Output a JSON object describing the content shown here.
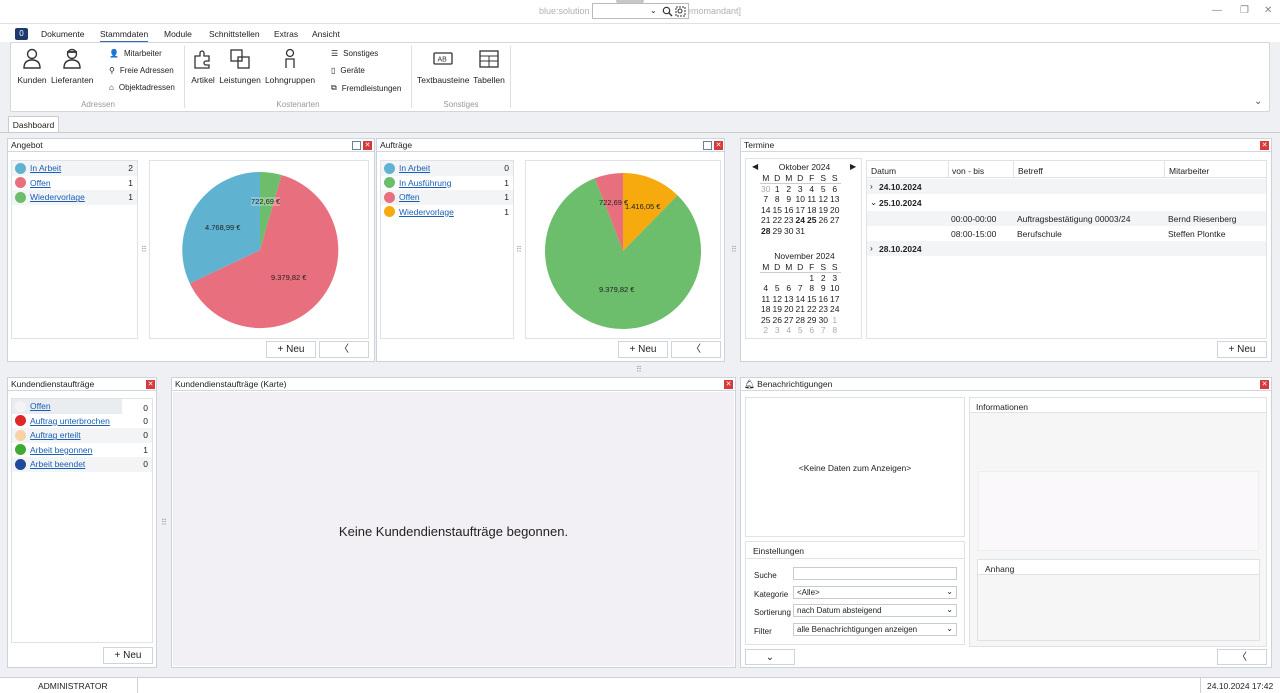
{
  "window": {
    "title": "blue:solution - smarthandwerk pro [Demomandant]",
    "badge": "0",
    "minimize": "—",
    "restore": "❐",
    "close": "✕"
  },
  "menu": {
    "dokumente": "Dokumente",
    "stammdaten": "Stammdaten",
    "module": "Module",
    "schnittstellen": "Schnittstellen",
    "extras": "Extras",
    "ansicht": "Ansicht"
  },
  "ribbon": {
    "kunden": "Kunden",
    "lieferanten": "Lieferanten",
    "mitarbeiter": "Mitarbeiter",
    "freie_adressen": "Freie Adressen",
    "objektadressen": "Objektadressen",
    "grp_adressen": "Adressen",
    "artikel": "Artikel",
    "leistungen": "Leistungen",
    "lohngruppen": "Lohngruppen",
    "sonstiges": "Sonstiges",
    "geraete": "Geräte",
    "fremdleistungen": "Fremdleistungen",
    "grp_kostenarten": "Kostenarten",
    "textbausteine": "Textbausteine",
    "tabellen": "Tabellen",
    "grp_sonstiges": "Sonstiges",
    "expand": "⌄"
  },
  "tab": {
    "dashboard": "Dashboard"
  },
  "angebot": {
    "title": "Angebot",
    "items": [
      {
        "label": "In Arbeit",
        "count": "2",
        "color": "#5fb3d0"
      },
      {
        "label": "Offen",
        "count": "1",
        "color": "#e8707e"
      },
      {
        "label": "Wiedervorlage",
        "count": "1",
        "color": "#6cbd6c"
      }
    ],
    "pie_labels": [
      "722,69 €",
      "4.768,99 €",
      "9.379,82 €"
    ],
    "new": "+ Neu",
    "back": "〈"
  },
  "auftraege": {
    "title": "Aufträge",
    "items": [
      {
        "label": "In Arbeit",
        "count": "0",
        "color": "#5fb3d0"
      },
      {
        "label": "In Ausführung",
        "count": "1",
        "color": "#6cbd6c"
      },
      {
        "label": "Offen",
        "count": "1",
        "color": "#e8707e"
      },
      {
        "label": "Wiedervorlage",
        "count": "1",
        "color": "#f6aa0e"
      }
    ],
    "pie_labels": [
      "722,69 €",
      "1.416,05 €",
      "9.379,82 €"
    ],
    "new": "+ Neu",
    "back": "〈"
  },
  "termine": {
    "title": "Termine",
    "cal1": {
      "month": "Oktober 2024",
      "days": [
        "M",
        "D",
        "M",
        "D",
        "F",
        "S",
        "S"
      ],
      "weeks": [
        [
          "30",
          "1",
          "2",
          "3",
          "4",
          "5",
          "6"
        ],
        [
          "7",
          "8",
          "9",
          "10",
          "11",
          "12",
          "13"
        ],
        [
          "14",
          "15",
          "16",
          "17",
          "18",
          "19",
          "20"
        ],
        [
          "21",
          "22",
          "23",
          "24",
          "25",
          "26",
          "27"
        ],
        [
          "28",
          "29",
          "30",
          "31",
          "",
          "",
          ""
        ]
      ]
    },
    "cal2": {
      "month": "November 2024",
      "days": [
        "M",
        "D",
        "M",
        "D",
        "F",
        "S",
        "S"
      ],
      "weeks": [
        [
          "",
          "",
          "",
          "",
          "1",
          "2",
          "3"
        ],
        [
          "4",
          "5",
          "6",
          "7",
          "8",
          "9",
          "10"
        ],
        [
          "11",
          "12",
          "13",
          "14",
          "15",
          "16",
          "17"
        ],
        [
          "18",
          "19",
          "20",
          "21",
          "22",
          "23",
          "24"
        ],
        [
          "25",
          "26",
          "27",
          "28",
          "29",
          "30",
          "1"
        ],
        [
          "2",
          "3",
          "4",
          "5",
          "6",
          "7",
          "8"
        ]
      ]
    },
    "prev": "◀",
    "next": "▶",
    "cols": {
      "datum": "Datum",
      "von_bis": "von - bis",
      "betreff": "Betreff",
      "mitarbeiter": "Mitarbeiter"
    },
    "groups": [
      {
        "date": "24.10.2024"
      },
      {
        "date": "25.10.2024"
      },
      {
        "date": "28.10.2024"
      }
    ],
    "rows": [
      {
        "time": "00:00-00:00",
        "betreff": "Auftragsbestätigung 00003/24",
        "ma": "Bernd Riesenberg"
      },
      {
        "time": "08:00-15:00",
        "betreff": "Berufschule",
        "ma": "Steffen Plontke"
      }
    ],
    "new": "+ Neu"
  },
  "kda": {
    "title": "Kundendienstaufträge",
    "items": [
      {
        "label": "Offen",
        "count": "0",
        "color": "#f4f4f6"
      },
      {
        "label": "Auftrag unterbrochen",
        "count": "0",
        "color": "#e02626"
      },
      {
        "label": "Auftrag erteilt",
        "count": "0",
        "color": "#f8d2a4"
      },
      {
        "label": "Arbeit begonnen",
        "count": "1",
        "color": "#3daa35"
      },
      {
        "label": "Arbeit beendet",
        "count": "0",
        "color": "#1f4a9a"
      }
    ],
    "new": "+ Neu"
  },
  "karte": {
    "title": "Kundendienstaufträge (Karte)",
    "empty": "Keine Kundendienstaufträge begonnen."
  },
  "benachrichtigungen": {
    "title": "Benachrichtigungen",
    "nodata": "<Keine Daten zum Anzeigen>",
    "info": "Informationen",
    "anhang": "Anhang",
    "einstellungen": "Einstellungen",
    "suche_lbl": "Suche",
    "kategorie_lbl": "Kategorie",
    "kategorie_val": "<Alle>",
    "sortierung_lbl": "Sortierung",
    "sortierung_val": "nach Datum absteigend",
    "filter_lbl": "Filter",
    "filter_val": "alle Benachrichtigungen anzeigen",
    "down": "⌄",
    "back": "〈"
  },
  "status": {
    "user": "ADMINISTRATOR",
    "datetime": "24.10.2024 17:42"
  }
}
